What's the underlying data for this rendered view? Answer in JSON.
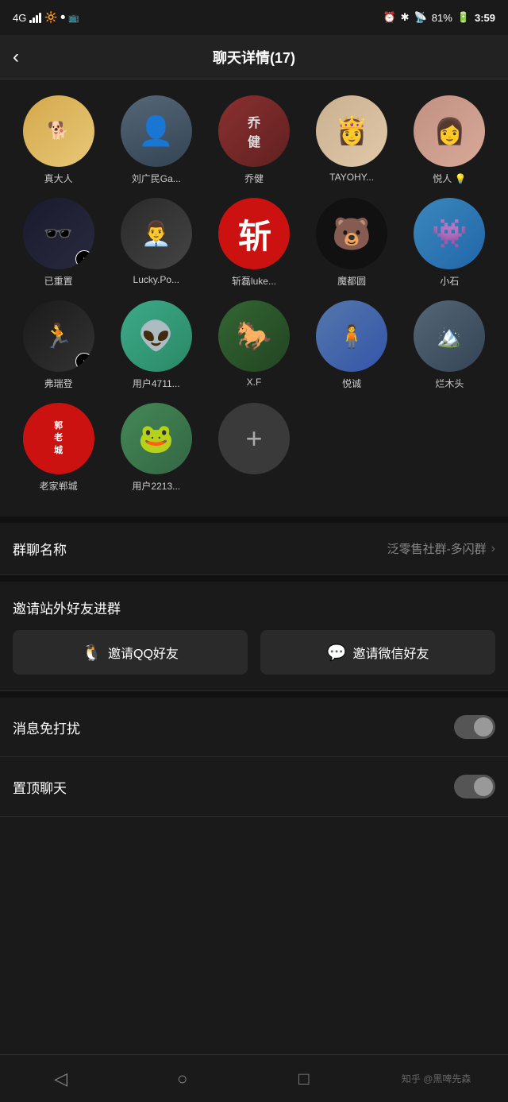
{
  "statusBar": {
    "signal": "4G",
    "time": "3:59",
    "battery": "81%",
    "icons": [
      "alarm",
      "bluetooth",
      "cast",
      "battery"
    ]
  },
  "header": {
    "title": "聊天详情(17)",
    "backLabel": "‹"
  },
  "members": [
    {
      "id": 1,
      "name": "真大人",
      "avatarType": "dog",
      "emoji": "🐕"
    },
    {
      "id": 2,
      "name": "刘广民Ga...",
      "avatarType": "silhouette"
    },
    {
      "id": 3,
      "name": "乔健",
      "avatarType": "red"
    },
    {
      "id": 4,
      "name": "TAYOHY...",
      "avatarType": "lady"
    },
    {
      "id": 5,
      "name": "悦人 💡",
      "avatarType": "vintage"
    },
    {
      "id": 6,
      "name": "已重置",
      "avatarType": "tiktok"
    },
    {
      "id": 7,
      "name": "Lucky.Po...",
      "avatarType": "lucky"
    },
    {
      "id": 8,
      "name": "斩磊luke...",
      "avatarType": "zhanl",
      "text": "斩"
    },
    {
      "id": 9,
      "name": "魔都圆",
      "avatarType": "kuma",
      "emoji": "🐻"
    },
    {
      "id": 10,
      "name": "小石",
      "avatarType": "alien"
    },
    {
      "id": 11,
      "name": "弗瑞登",
      "avatarType": "run"
    },
    {
      "id": 12,
      "name": "用户4711...",
      "avatarType": "monster"
    },
    {
      "id": 13,
      "name": "X.F",
      "avatarType": "horse"
    },
    {
      "id": 14,
      "name": "悦诚",
      "avatarType": "portrait"
    },
    {
      "id": 15,
      "name": "烂木头",
      "avatarType": "outdoor"
    },
    {
      "id": 16,
      "name": "老家郸城",
      "avatarType": "stamp",
      "text": "郭\n老\n城"
    },
    {
      "id": 17,
      "name": "用户2213...",
      "avatarType": "frog"
    }
  ],
  "addButton": {
    "label": "+",
    "name": ""
  },
  "settings": {
    "groupNameLabel": "群聊名称",
    "groupNameValue": "泛零售社群-多闪群",
    "inviteTitle": "邀请站外好友进群",
    "inviteQQ": "邀请QQ好友",
    "inviteWechat": "邀请微信好友",
    "doNotDisturbLabel": "消息免打扰",
    "pinChatLabel": "置顶聊天"
  },
  "bottomNav": {
    "back": "◁",
    "home": "○",
    "recents": "□",
    "brand": "知乎 @黑啤先森"
  }
}
